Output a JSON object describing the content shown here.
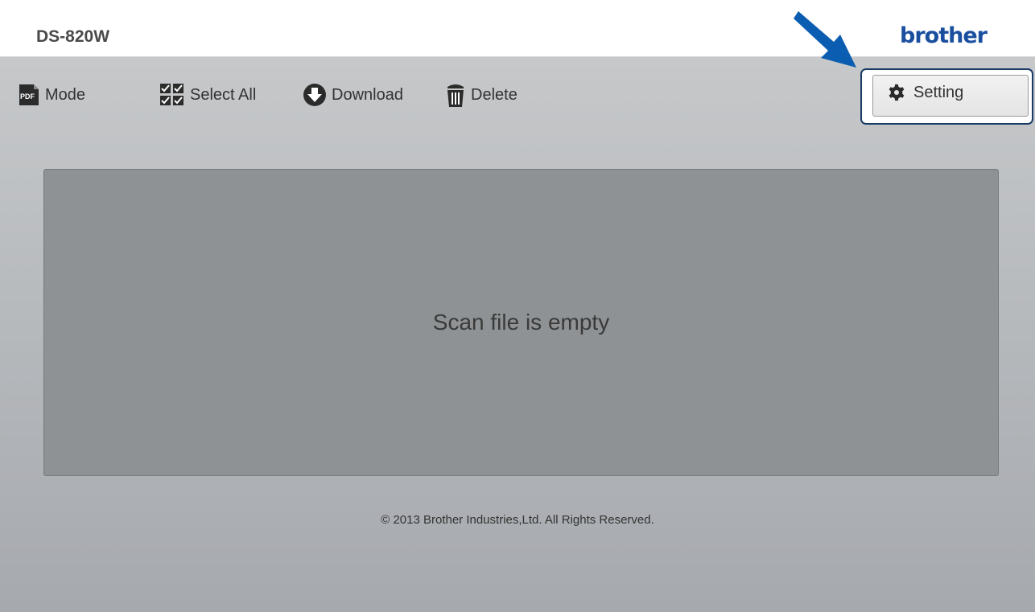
{
  "header": {
    "model_name": "DS-820W",
    "brand": "brother"
  },
  "toolbar": {
    "mode": {
      "icon": "pdf-icon",
      "icon_text": "PDF",
      "label": "Mode"
    },
    "select_all": {
      "icon": "select-all-icon",
      "label": "Select All"
    },
    "download": {
      "icon": "download-icon",
      "label": "Download"
    },
    "delete": {
      "icon": "trash-icon",
      "label": "Delete"
    },
    "setting": {
      "icon": "gear-icon",
      "label": "Setting"
    }
  },
  "main": {
    "empty_message": "Scan file is empty"
  },
  "footer": {
    "copyright": "© 2013 Brother Industries,Ltd. All Rights Reserved."
  },
  "colors": {
    "brand": "#1a4fa0",
    "arrow": "#0a5db0",
    "highlight_frame": "#1b3c66",
    "panel": "#8f9294"
  }
}
